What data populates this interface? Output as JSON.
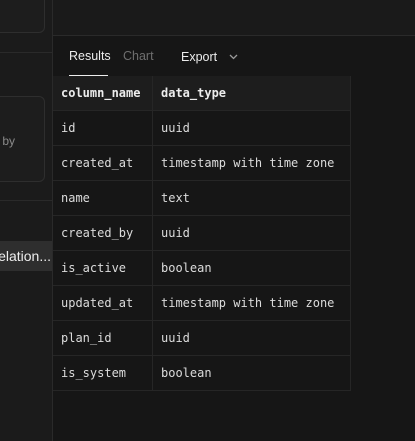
{
  "sidebar": {
    "partial_text_by": "by",
    "relation_button": "elation..."
  },
  "tabs": {
    "results": "Results",
    "chart": "Chart",
    "export": "Export",
    "export_icon": "chevron-down-icon"
  },
  "table": {
    "headers": [
      "column_name",
      "data_type"
    ],
    "rows": [
      [
        "id",
        "uuid"
      ],
      [
        "created_at",
        "timestamp with time zone"
      ],
      [
        "name",
        "text"
      ],
      [
        "created_by",
        "uuid"
      ],
      [
        "is_active",
        "boolean"
      ],
      [
        "updated_at",
        "timestamp with time zone"
      ],
      [
        "plan_id",
        "uuid"
      ],
      [
        "is_system",
        "boolean"
      ]
    ]
  },
  "colors": {
    "background": "#161616",
    "header_bg": "#1d1d1d",
    "active_tab": "#ededed",
    "inactive_tab": "#6e6e6e"
  }
}
